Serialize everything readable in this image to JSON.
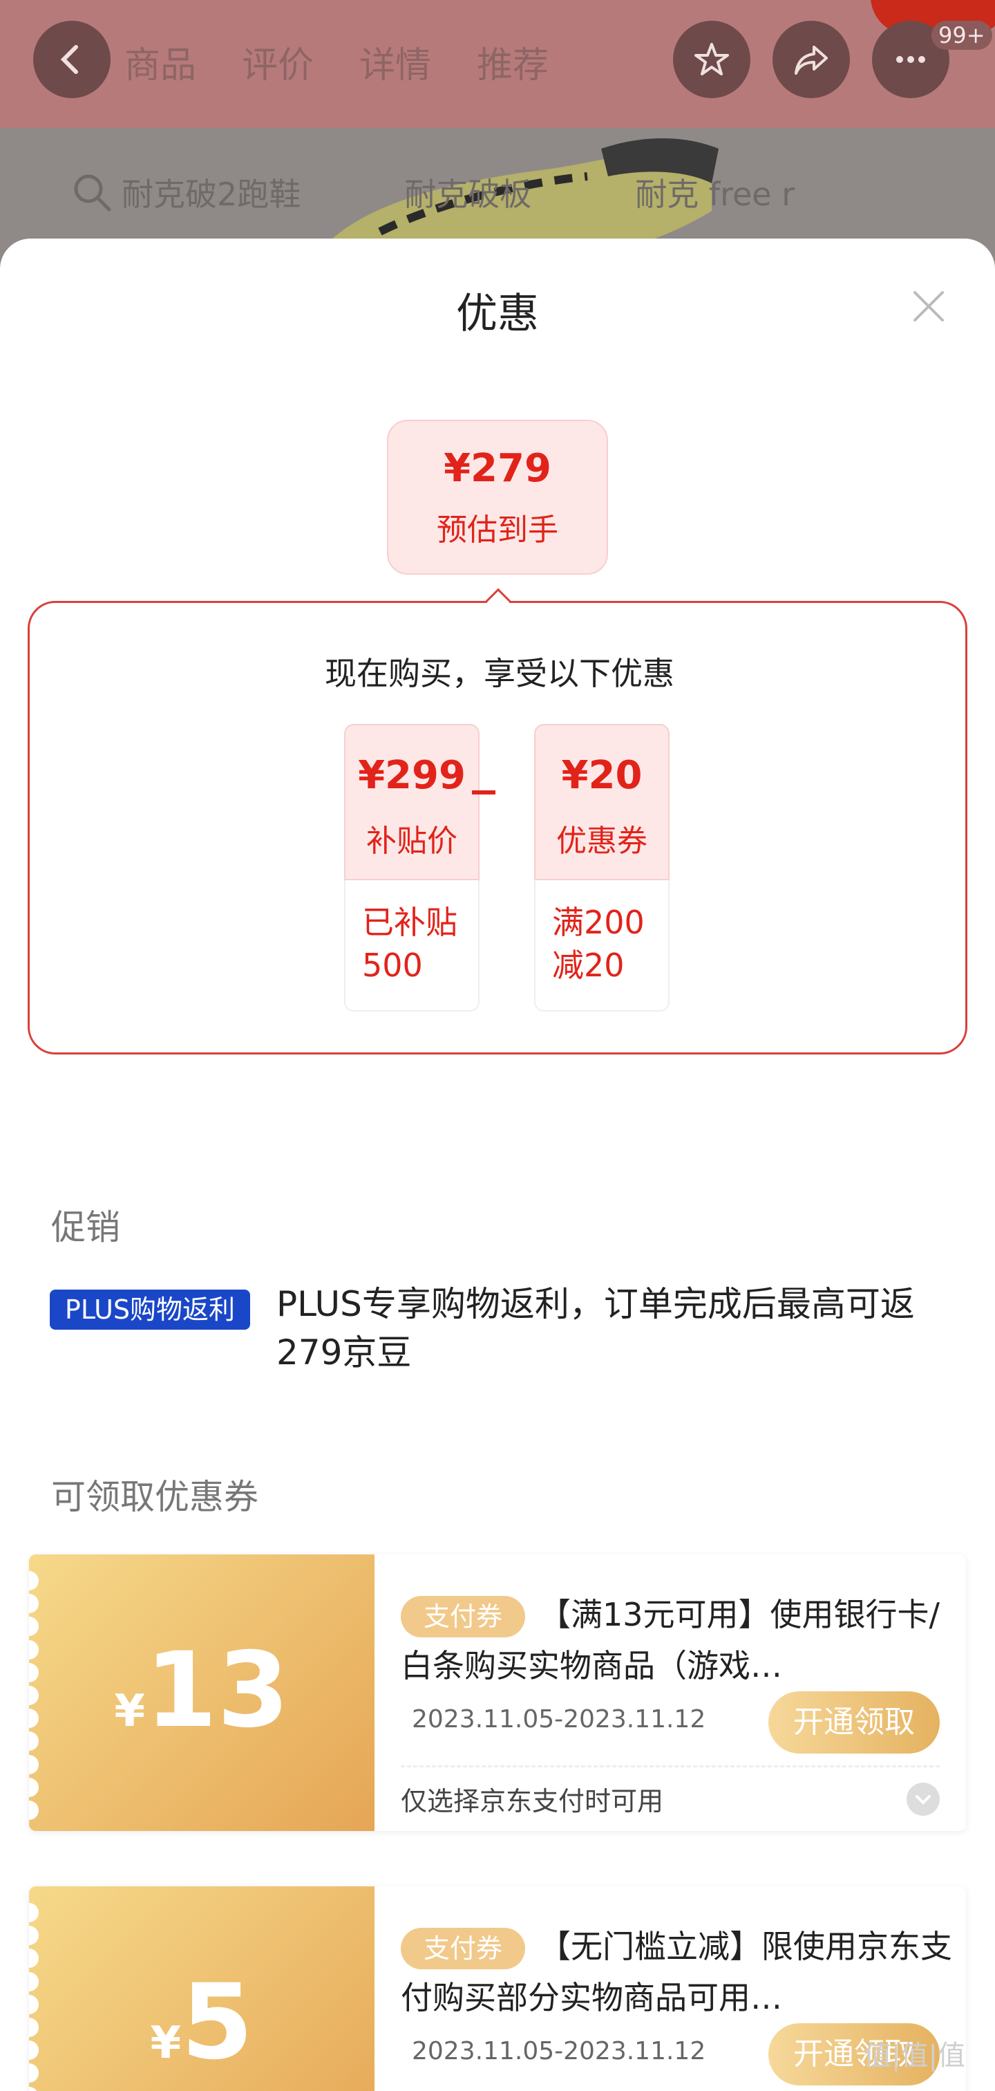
{
  "header": {
    "tabs": [
      "商品",
      "评价",
      "详情",
      "推荐"
    ],
    "badge": "99+"
  },
  "search": {
    "items": [
      "耐克破2跑鞋",
      "耐克破板",
      "耐克 free r"
    ]
  },
  "sheet": {
    "title": "优惠",
    "estimate": {
      "price": "¥279",
      "label": "预估到手"
    },
    "benefits": {
      "title": "现在购买，享受以下优惠",
      "cards": [
        {
          "value": "¥299",
          "label": "补贴价",
          "detail_line1": "已补贴",
          "detail_line2": "500"
        },
        {
          "value": "¥20",
          "label": "优惠券",
          "detail_line1": "满200",
          "detail_line2": "减20"
        }
      ]
    },
    "promo_section": "促销",
    "promo": {
      "tag": "PLUS购物返利",
      "text": "PLUS专享购物返利，订单完成后最高可返279京豆"
    },
    "coupon_section": "可领取优惠券",
    "coupons": [
      {
        "currency": "¥",
        "amount": "13",
        "tag": "支付券",
        "description": "【满13元可用】使用银行卡/白条购买实物商品（游戏…",
        "date": "2023.11.05-2023.11.12",
        "button": "开通领取",
        "note": "仅选择京东支付时可用"
      },
      {
        "currency": "¥",
        "amount": "5",
        "tag": "支付券",
        "description": "【无门槛立减】限使用京东支付购买部分实物商品可用…",
        "date": "2023.11.05-2023.11.12",
        "button": "开通领取"
      }
    ]
  },
  "watermark": "值|值|值",
  "colors": {
    "accent": "#e2231a",
    "coupon_gold": "#e5a656",
    "plus_blue": "#1a47c8"
  }
}
